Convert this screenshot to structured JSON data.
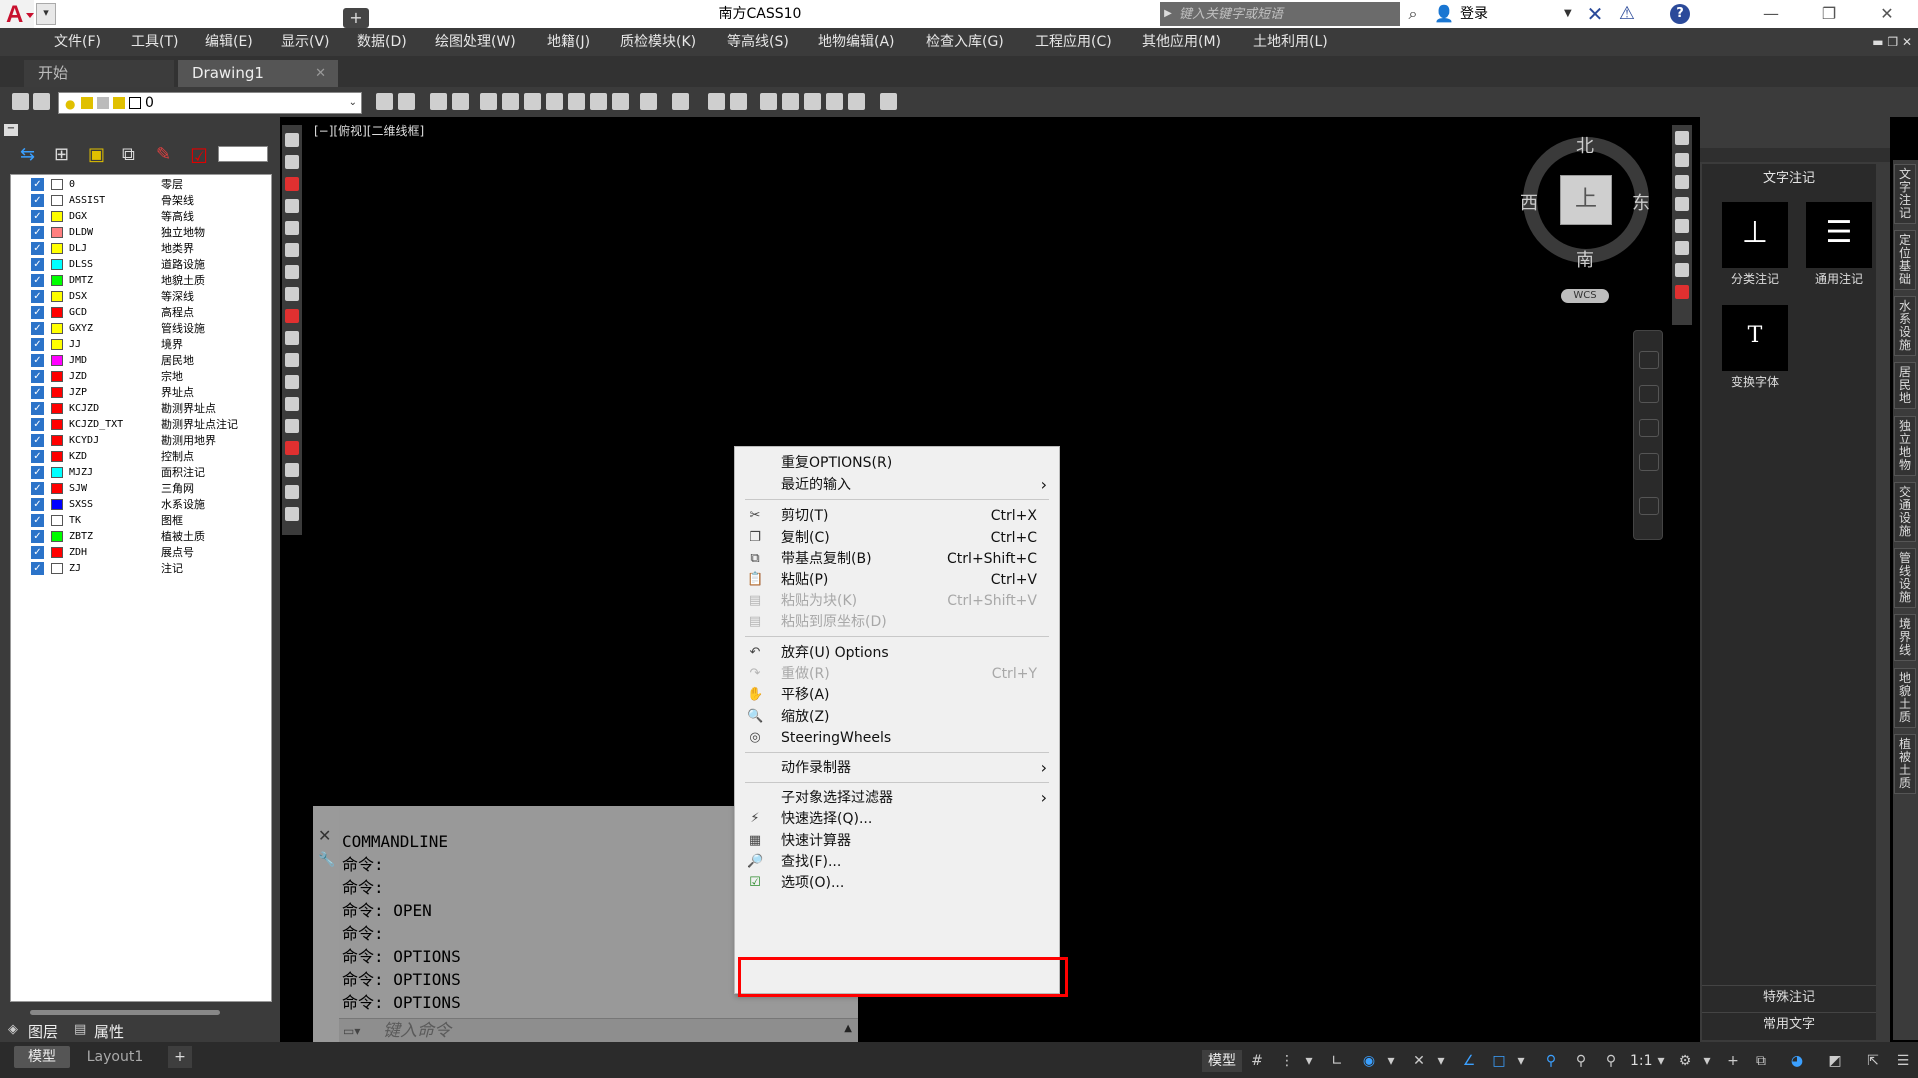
{
  "title_bar": {
    "app_title": "南方CASS10",
    "search_placeholder": "键入关键字或短语",
    "login_label": "登录"
  },
  "menu": [
    "文件(F)",
    "工具(T)",
    "编辑(E)",
    "显示(V)",
    "数据(D)",
    "绘图处理(W)",
    "地籍(J)",
    "质检模块(K)",
    "等高线(S)",
    "地物编辑(A)",
    "检查入库(G)",
    "工程应用(C)",
    "其他应用(M)",
    "土地利用(L)"
  ],
  "tabs": {
    "start": "开始",
    "drawing": "Drawing1",
    "close_glyph": "✕",
    "add": "+"
  },
  "toolbar": {
    "current_layer": "0"
  },
  "layers": [
    {
      "name": "0",
      "desc": "零层",
      "color": "#ffffff"
    },
    {
      "name": "ASSIST",
      "desc": "骨架线",
      "color": "#ffffff"
    },
    {
      "name": "DGX",
      "desc": "等高线",
      "color": "#ffff00"
    },
    {
      "name": "DLDW",
      "desc": "独立地物",
      "color": "#ff7f7f"
    },
    {
      "name": "DLJ",
      "desc": "地类界",
      "color": "#ffff00"
    },
    {
      "name": "DLSS",
      "desc": "道路设施",
      "color": "#00ffff"
    },
    {
      "name": "DMTZ",
      "desc": "地貌土质",
      "color": "#00ff00"
    },
    {
      "name": "DSX",
      "desc": "等深线",
      "color": "#ffff00"
    },
    {
      "name": "GCD",
      "desc": "高程点",
      "color": "#ff0000"
    },
    {
      "name": "GXYZ",
      "desc": "管线设施",
      "color": "#ffff00"
    },
    {
      "name": "JJ",
      "desc": "境界",
      "color": "#ffff00"
    },
    {
      "name": "JMD",
      "desc": "居民地",
      "color": "#ff00ff"
    },
    {
      "name": "JZD",
      "desc": "宗地",
      "color": "#ff0000"
    },
    {
      "name": "JZP",
      "desc": "界址点",
      "color": "#ff0000"
    },
    {
      "name": "KCJZD",
      "desc": "勘测界址点",
      "color": "#ff0000"
    },
    {
      "name": "KCJZD_TXT",
      "desc": "勘测界址点注记",
      "color": "#ff0000"
    },
    {
      "name": "KCYDJ",
      "desc": "勘测用地界",
      "color": "#ff0000"
    },
    {
      "name": "KZD",
      "desc": "控制点",
      "color": "#ff0000"
    },
    {
      "name": "MJZJ",
      "desc": "面积注记",
      "color": "#00ffff"
    },
    {
      "name": "SJW",
      "desc": "三角网",
      "color": "#ff0000"
    },
    {
      "name": "SXSS",
      "desc": "水系设施",
      "color": "#0000ff"
    },
    {
      "name": "TK",
      "desc": "图框",
      "color": "#ffffff"
    },
    {
      "name": "ZBTZ",
      "desc": "植被土质",
      "color": "#00ff00"
    },
    {
      "name": "ZDH",
      "desc": "展点号",
      "color": "#ff0000"
    },
    {
      "name": "ZJ",
      "desc": "注记",
      "color": "#ffffff"
    }
  ],
  "panel_bottom": {
    "layers_tab": "图层",
    "props_tab": "属性"
  },
  "viewport": {
    "label": "[−][俯视][二维线框]",
    "north": "北",
    "south": "南",
    "east": "东",
    "west": "西",
    "cube_face": "上",
    "wcs": "WCS"
  },
  "command": {
    "history": [
      "COMMANDLINE",
      "命令:",
      "命令:",
      "命令: OPEN",
      "命令:",
      "命令: OPTIONS",
      "命令: OPTIONS",
      "命令: OPTIONS"
    ],
    "placeholder": "键入命令"
  },
  "context_menu": {
    "repeat": "重复OPTIONS(R)",
    "recent": "最近的输入",
    "cut": "剪切(T)",
    "cut_sc": "Ctrl+X",
    "copy": "复制(C)",
    "copy_sc": "Ctrl+C",
    "copy_base": "带基点复制(B)",
    "copy_base_sc": "Ctrl+Shift+C",
    "paste": "粘贴(P)",
    "paste_sc": "Ctrl+V",
    "paste_block": "粘贴为块(K)",
    "paste_block_sc": "Ctrl+Shift+V",
    "paste_orig": "粘贴到原坐标(D)",
    "undo": "放弃(U) Options",
    "redo": "重做(R)",
    "redo_sc": "Ctrl+Y",
    "pan": "平移(A)",
    "zoom": "缩放(Z)",
    "steering": "SteeringWheels",
    "action_recorder": "动作录制器",
    "subobject_filter": "子对象选择过滤器",
    "quick_select": "快速选择(Q)...",
    "quickcalc": "快速计算器",
    "find": "查找(F)...",
    "options": "选项(O)..."
  },
  "palette": {
    "header": "文字注记",
    "tool1": "分类注记",
    "tool2": "通用注记",
    "tool3": "变换字体",
    "tool3_glyph": "T",
    "footer1": "特殊注记",
    "footer2": "常用文字",
    "side_tabs": [
      "文字注记",
      "定位基础",
      "水系设施",
      "居民地",
      "独立地物",
      "交通设施",
      "管线设施",
      "境界线",
      "地貌土质",
      "植被土质"
    ]
  },
  "status": {
    "model_tab": "模型",
    "layout_tab": "Layout1",
    "add": "+",
    "model_btn": "模型",
    "scale": "1:1"
  },
  "colors": {
    "accent_blue": "#2b4a9a",
    "highlight_red": "#ff0000",
    "app_red": "#c8102e"
  }
}
